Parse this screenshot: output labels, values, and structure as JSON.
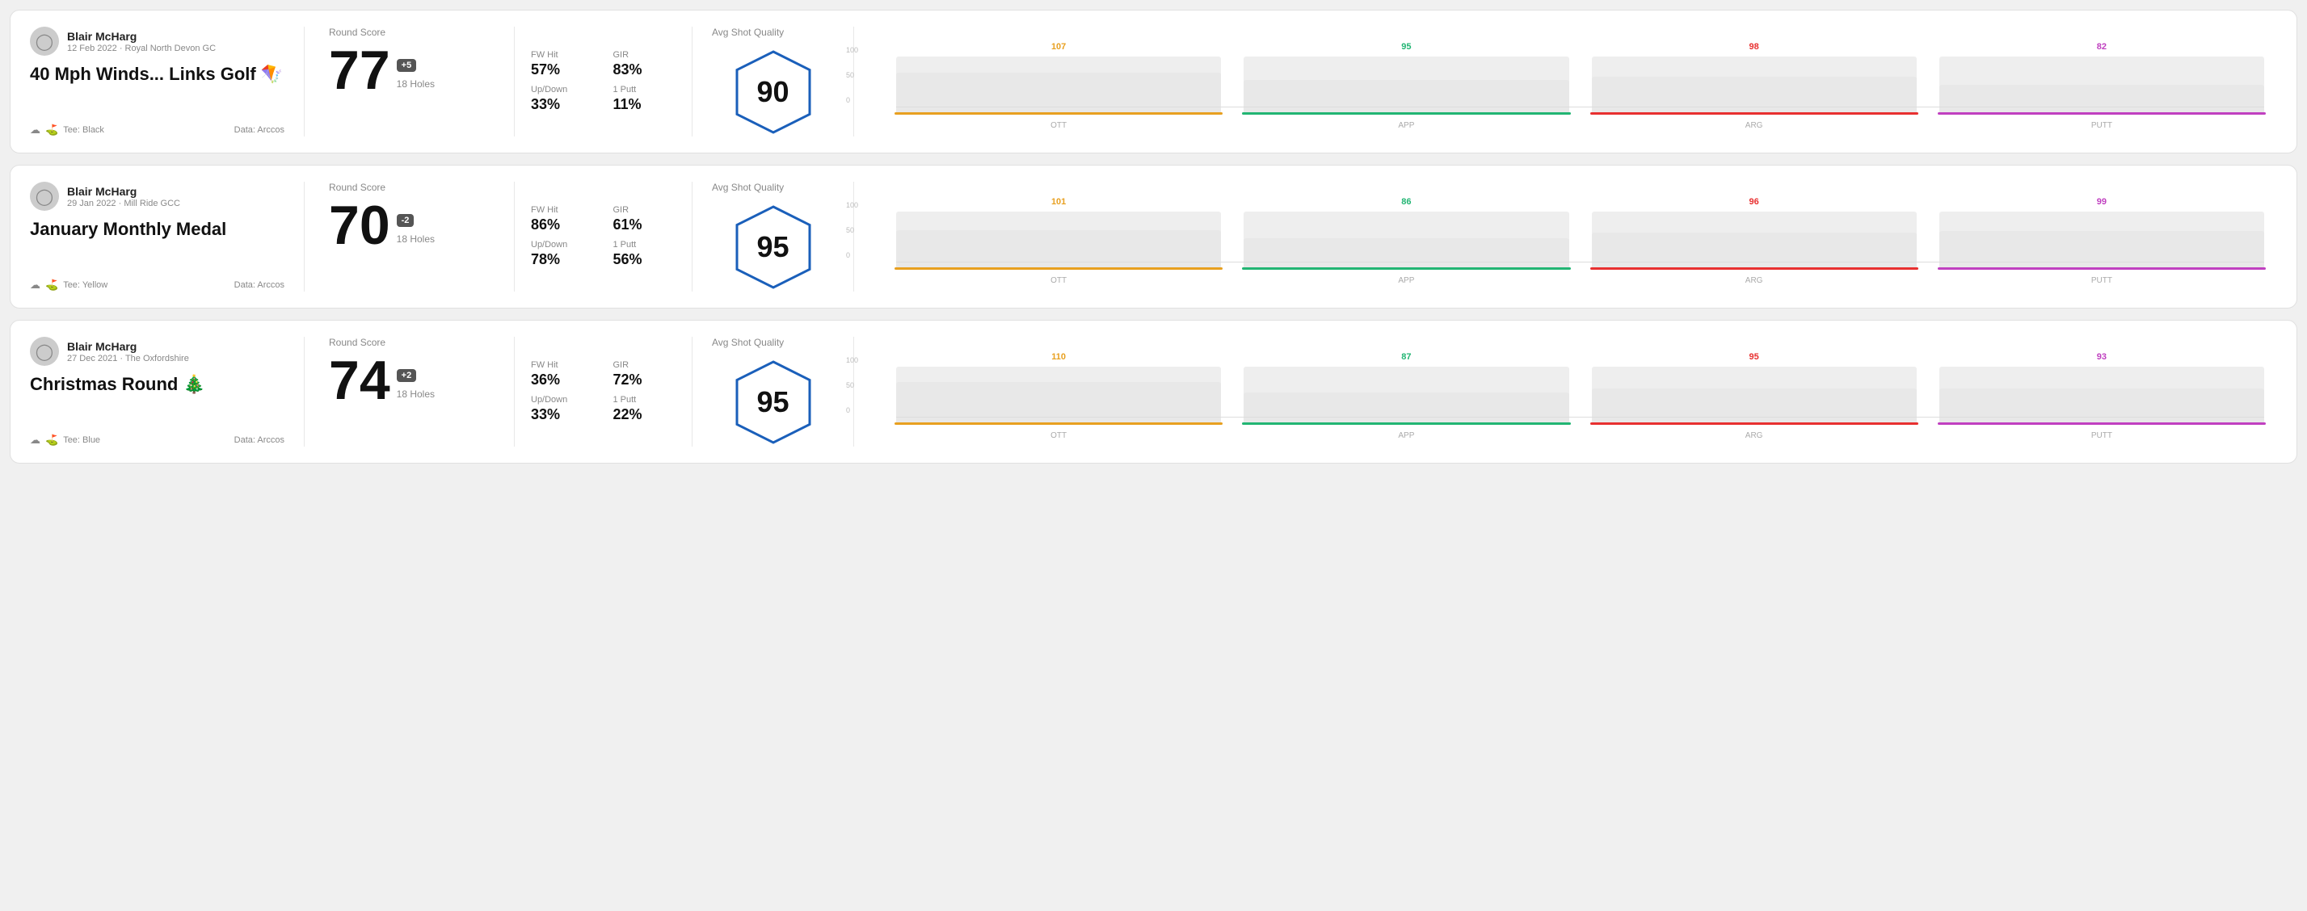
{
  "rounds": [
    {
      "id": "round-1",
      "user": {
        "name": "Blair McHarg",
        "date": "12 Feb 2022 · Royal North Devon GC"
      },
      "title": "40 Mph Winds... Links Golf 🪁",
      "tee": "Black",
      "data_source": "Data: Arccos",
      "round_score_label": "Round Score",
      "score": "77",
      "badge": "+5",
      "holes": "18 Holes",
      "fw_hit_label": "FW Hit",
      "fw_hit": "57%",
      "gir_label": "GIR",
      "gir": "83%",
      "updown_label": "Up/Down",
      "updown": "33%",
      "oneputt_label": "1 Putt",
      "oneputt": "11%",
      "avg_shot_quality_label": "Avg Shot Quality",
      "quality": "90",
      "chart": {
        "bars": [
          {
            "label": "OTT",
            "value": 107,
            "color": "#e8a020",
            "pct": 72
          },
          {
            "label": "APP",
            "value": 95,
            "color": "#22b573",
            "pct": 60
          },
          {
            "label": "ARG",
            "value": 98,
            "color": "#e83030",
            "pct": 65
          },
          {
            "label": "PUTT",
            "value": 82,
            "color": "#c040c0",
            "pct": 52
          }
        ],
        "y_labels": [
          "100",
          "50",
          "0"
        ]
      }
    },
    {
      "id": "round-2",
      "user": {
        "name": "Blair McHarg",
        "date": "29 Jan 2022 · Mill Ride GCC"
      },
      "title": "January Monthly Medal",
      "tee": "Yellow",
      "data_source": "Data: Arccos",
      "round_score_label": "Round Score",
      "score": "70",
      "badge": "-2",
      "holes": "18 Holes",
      "fw_hit_label": "FW Hit",
      "fw_hit": "86%",
      "gir_label": "GIR",
      "gir": "61%",
      "updown_label": "Up/Down",
      "updown": "78%",
      "oneputt_label": "1 Putt",
      "oneputt": "56%",
      "avg_shot_quality_label": "Avg Shot Quality",
      "quality": "95",
      "chart": {
        "bars": [
          {
            "label": "OTT",
            "value": 101,
            "color": "#e8a020",
            "pct": 68
          },
          {
            "label": "APP",
            "value": 86,
            "color": "#22b573",
            "pct": 54
          },
          {
            "label": "ARG",
            "value": 96,
            "color": "#e83030",
            "pct": 64
          },
          {
            "label": "PUTT",
            "value": 99,
            "color": "#c040c0",
            "pct": 66
          }
        ],
        "y_labels": [
          "100",
          "50",
          "0"
        ]
      }
    },
    {
      "id": "round-3",
      "user": {
        "name": "Blair McHarg",
        "date": "27 Dec 2021 · The Oxfordshire"
      },
      "title": "Christmas Round 🎄",
      "tee": "Blue",
      "data_source": "Data: Arccos",
      "round_score_label": "Round Score",
      "score": "74",
      "badge": "+2",
      "holes": "18 Holes",
      "fw_hit_label": "FW Hit",
      "fw_hit": "36%",
      "gir_label": "GIR",
      "gir": "72%",
      "updown_label": "Up/Down",
      "updown": "33%",
      "oneputt_label": "1 Putt",
      "oneputt": "22%",
      "avg_shot_quality_label": "Avg Shot Quality",
      "quality": "95",
      "chart": {
        "bars": [
          {
            "label": "OTT",
            "value": 110,
            "color": "#e8a020",
            "pct": 74
          },
          {
            "label": "APP",
            "value": 87,
            "color": "#22b573",
            "pct": 55
          },
          {
            "label": "ARG",
            "value": 95,
            "color": "#e83030",
            "pct": 63
          },
          {
            "label": "PUTT",
            "value": 93,
            "color": "#c040c0",
            "pct": 62
          }
        ],
        "y_labels": [
          "100",
          "50",
          "0"
        ]
      }
    }
  ]
}
